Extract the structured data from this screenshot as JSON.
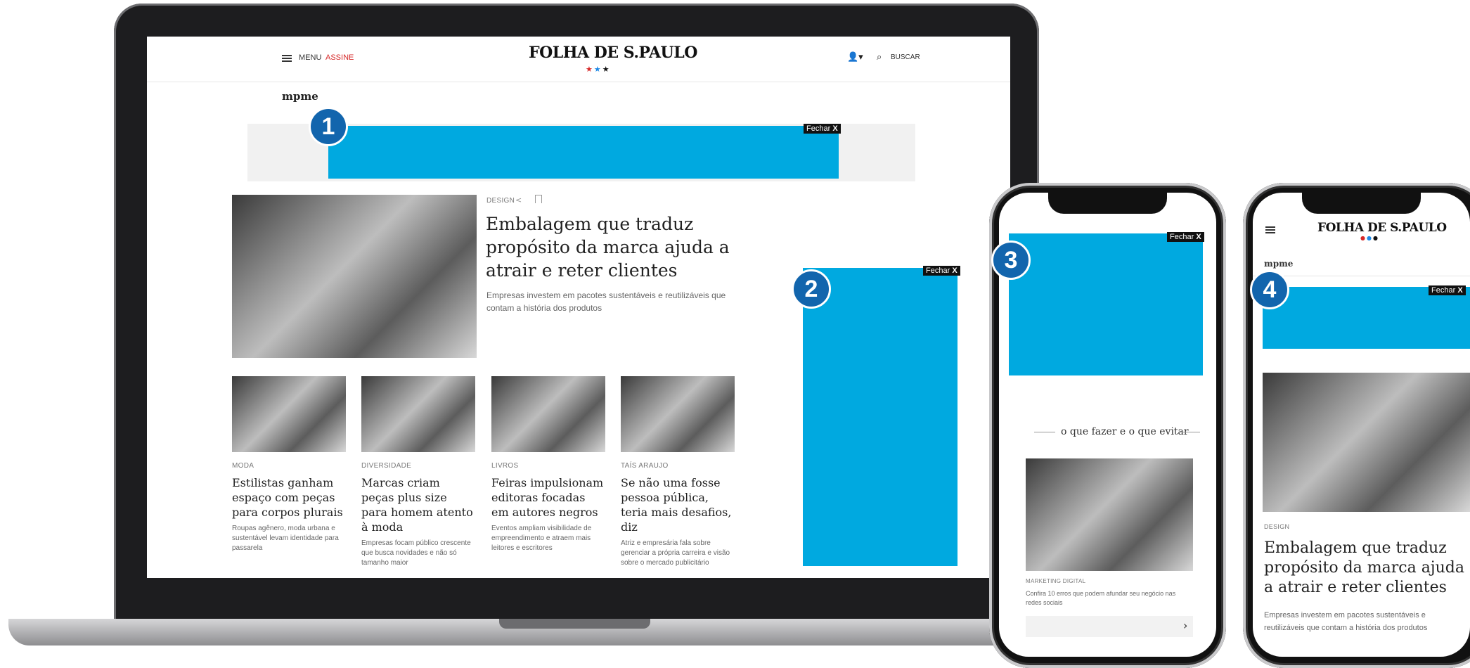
{
  "desktop": {
    "header": {
      "menu_label": "MENU",
      "subscribe_label": "ASSINE",
      "logo": "FOLHA DE S.PAULO",
      "search_label": "BUSCAR"
    },
    "section_title": "mpme",
    "ads": {
      "close_label": "Fechar",
      "close_x": "X"
    },
    "badges": [
      "1",
      "2",
      "3",
      "4"
    ],
    "lead": {
      "tag": "DESIGN",
      "headline": "Embalagem que traduz propósito da marca ajuda a atrair e reter clientes",
      "summary": "Empresas investem em pacotes sustentáveis e reutilizáveis que contam a história dos produtos"
    },
    "cards": [
      {
        "tag": "MODA",
        "headline": "Estilistas ganham espaço com peças para corpos plurais",
        "summary": "Roupas agênero, moda urbana e sustentável levam identidade para passarela"
      },
      {
        "tag": "DIVERSIDADE",
        "headline": "Marcas criam peças plus size para homem atento à moda",
        "summary": "Empresas focam público crescente que busca novidades e não só tamanho maior"
      },
      {
        "tag": "LIVROS",
        "headline": "Feiras impulsionam editoras focadas em autores negros",
        "summary": "Eventos ampliam visibilidade de empreendimento e atraem mais leitores e escritores"
      },
      {
        "tag": "TAÍS ARAUJO",
        "headline": "Se não uma fosse pessoa pública, teria mais desafios, diz",
        "summary": "Atriz e empresária fala sobre gerenciar a própria carreira e visão sobre o mercado publicitário"
      }
    ]
  },
  "phone1": {
    "section_title": "o que fazer e o que evitar",
    "tag": "MARKETING DIGITAL",
    "summary": "Confira 10 erros que podem afundar seu negócio nas redes sociais",
    "next_arrow": "›"
  },
  "phone2": {
    "logo": "FOLHA DE S.PAULO",
    "section_title": "mpme",
    "tag": "DESIGN",
    "headline": "Embalagem que traduz propósito da marca ajuda a atrair e reter clientes",
    "summary": "Empresas investem em pacotes sustentáveis e reutilizáveis que contam a história dos produtos"
  },
  "colors": {
    "ad_blue": "#00a9e0",
    "badge_blue": "#1265ad",
    "subscribe_red": "#d62828"
  }
}
